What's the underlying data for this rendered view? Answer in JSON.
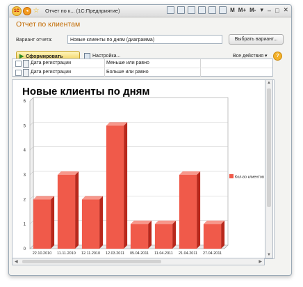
{
  "window": {
    "title": "Отчет по к... (1С:Предприятие)",
    "toolbar_m": [
      "M",
      "M+",
      "M-"
    ]
  },
  "form": {
    "title": "Отчет по клиентам",
    "variant_label": "Вариант отчета:",
    "variant_value": "Новые клиенты по дням (диаграмма)",
    "choose_variant_label": "Выбрать вариант...",
    "run_label": "Сформировать",
    "settings_label": "Настройка...",
    "all_actions_label": "Все действия",
    "help_label": "?"
  },
  "filters": [
    {
      "field": "Дата регистрации",
      "condition": "Меньше или равно"
    },
    {
      "field": "Дата регистрации",
      "condition": "Больше или равно"
    }
  ],
  "chart_data": {
    "type": "bar",
    "title": "Новые клиенты по дням",
    "categories": [
      "22.10.2010",
      "11.11.2010",
      "12.11.2010",
      "12.03.2011",
      "05.04.2011",
      "11.04.2011",
      "21.04.2011",
      "27.04.2011"
    ],
    "series": [
      {
        "name": "Кол-во клиентов",
        "values": [
          2,
          3,
          2,
          5,
          1,
          1,
          3,
          1
        ],
        "color": "#f05a4a"
      }
    ],
    "ylim": [
      0,
      6
    ],
    "yticks": [
      "0",
      "1",
      "2",
      "3",
      "4",
      "5",
      "6"
    ],
    "grid": true,
    "legend": "right"
  },
  "colors": {
    "bar_front": "#f05a4a",
    "bar_side": "#b8281c",
    "bar_top": "#f7978b",
    "accent": "#c26a00"
  }
}
